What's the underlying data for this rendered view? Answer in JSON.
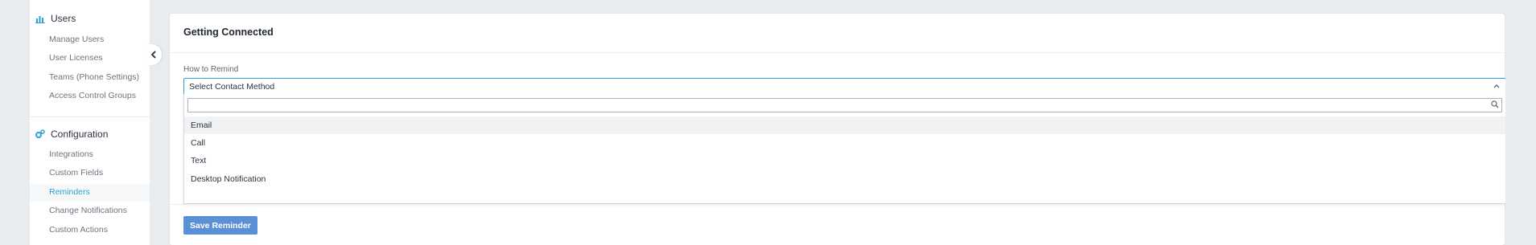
{
  "sidebar": {
    "sections": [
      {
        "label": "Users",
        "icon": "bar-chart-icon",
        "items": [
          {
            "label": "Manage Users"
          },
          {
            "label": "User Licenses"
          },
          {
            "label": "Teams (Phone Settings)"
          },
          {
            "label": "Access Control Groups"
          }
        ]
      },
      {
        "label": "Configuration",
        "icon": "cogs-icon",
        "items": [
          {
            "label": "Integrations"
          },
          {
            "label": "Custom Fields"
          },
          {
            "label": "Reminders"
          },
          {
            "label": "Change Notifications"
          },
          {
            "label": "Custom Actions"
          }
        ]
      }
    ],
    "active_item": "Reminders",
    "accent_color": "#2ba3d8"
  },
  "main": {
    "title": "Getting Connected",
    "field_label": "How to Remind",
    "select": {
      "value": "Select Contact Method",
      "search_value": "",
      "options": [
        {
          "label": "Email"
        },
        {
          "label": "Call"
        },
        {
          "label": "Text"
        },
        {
          "label": "Desktop Notification"
        }
      ]
    },
    "save_button_label": "Save Reminder",
    "button_color": "#5b8fd6"
  }
}
